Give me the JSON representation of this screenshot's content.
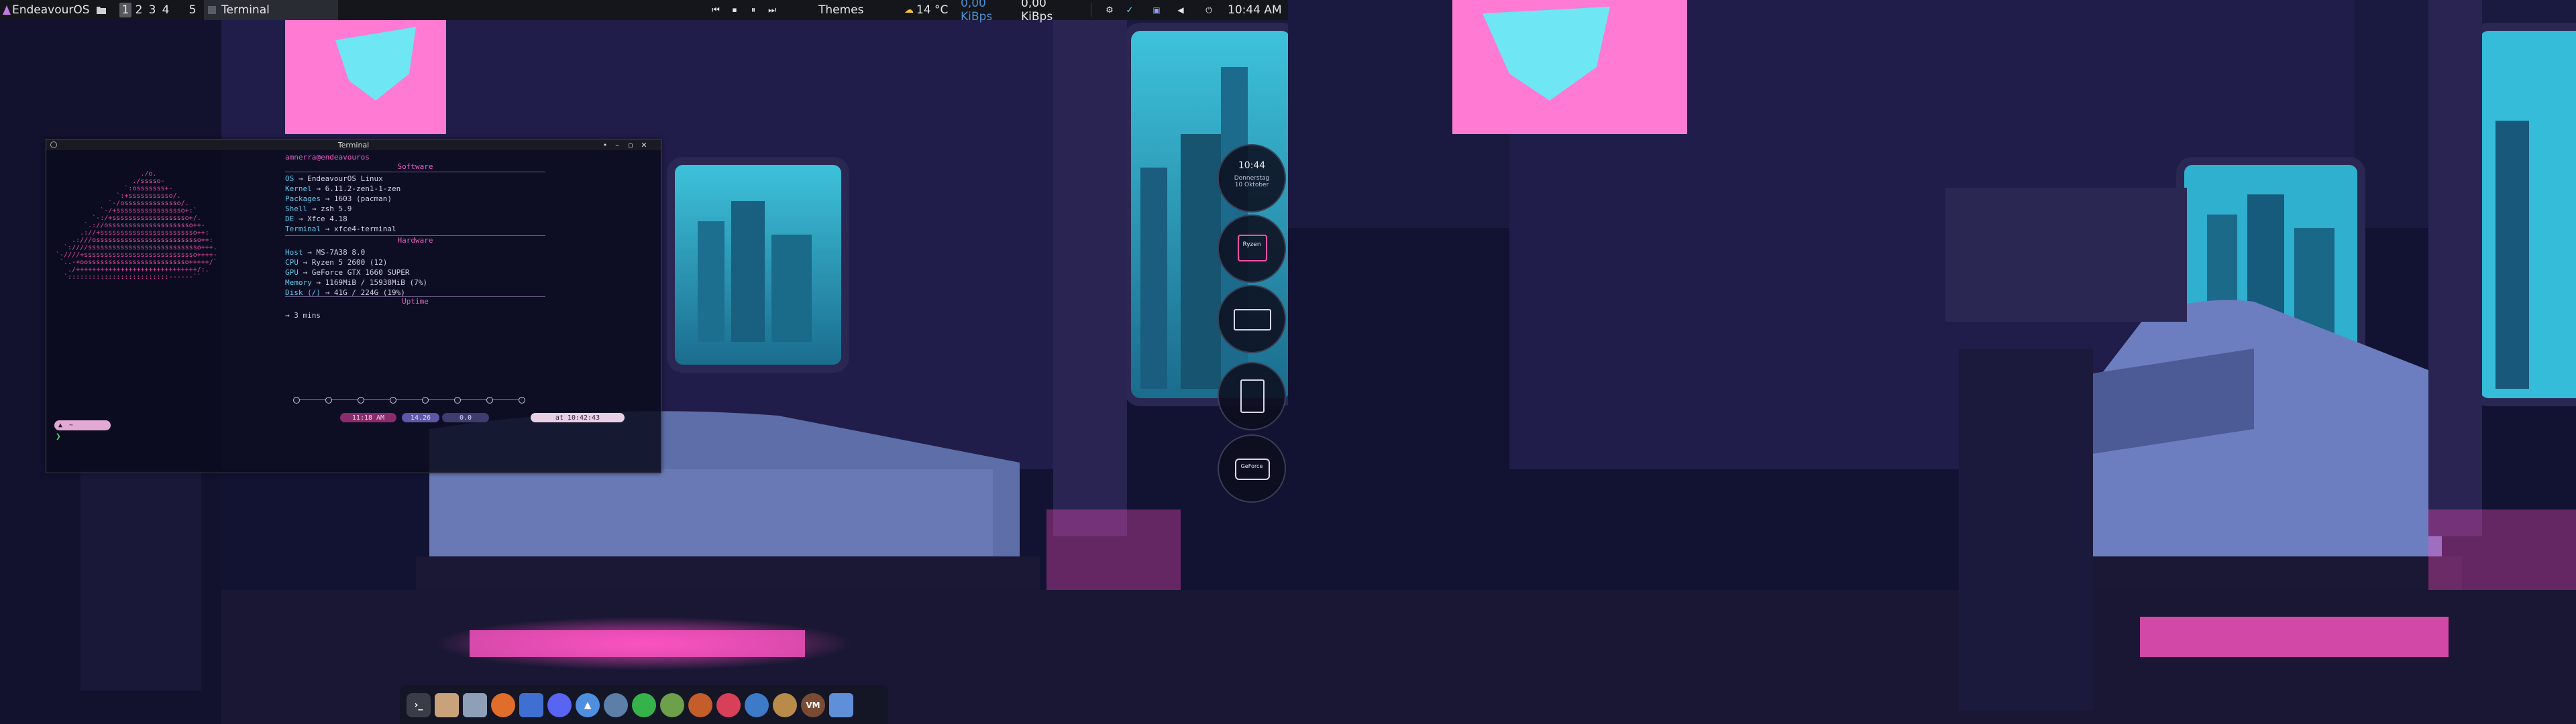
{
  "top_panel": {
    "app_menu_label": "EndeavourOS",
    "workspaces": [
      "1",
      "2",
      "3",
      "4",
      "5"
    ],
    "active_workspace": "1",
    "window_button_label": "Terminal",
    "themes_label": "Themes",
    "weather": "14 °C",
    "net_down": "0,00 KiBps",
    "net_up": "0,00 KiBps",
    "clock": "10:44 AM"
  },
  "terminal": {
    "title": "Terminal",
    "prompt_user": "amnerra@endeavouros",
    "ascii_logo": "                     ./o.\n                   ./sssso-\n                 `:osssssss+-\n               `:+sssssssssso/.\n             `-/ossssssssssssso/.\n           `-/+sssssssssssssssso+:`\n         `-:/+sssssssssssssssssso+/.\n       `.://osssssssssssssssssssso++-\n      .://+ssssssssssssssssssssssso++:\n    .:///ossssssssssssssssssssssssso++:\n  `:////ssssssssssssssssssssssssssso+++.\n`-////+ssssssssssssssssssssssssssso++++-\n `..-+oosssssssssssssssssssssssso+++++/`\n   ./++++++++++++++++++++++++++++++/:.\n  `:::::::::::::::::::::::::------``",
    "section_software": "Software",
    "section_hardware": "Hardware",
    "section_uptime": "Uptime",
    "arrow": "→",
    "software": [
      {
        "key": "OS",
        "value": "EndeavourOS Linux"
      },
      {
        "key": "Kernel",
        "value": "6.11.2-zen1-1-zen"
      },
      {
        "key": "Packages",
        "value": "1603 (pacman)"
      },
      {
        "key": "Shell",
        "value": "zsh 5.9"
      },
      {
        "key": "DE",
        "value": "Xfce 4.18"
      },
      {
        "key": "Terminal",
        "value": "xfce4-terminal"
      }
    ],
    "hardware": [
      {
        "key": "Host",
        "value": "MS-7A38 8.0"
      },
      {
        "key": "CPU",
        "value": "Ryzen 5 2600 (12)"
      },
      {
        "key": "GPU",
        "value": "GeForce GTX 1660 SUPER"
      },
      {
        "key": "Memory",
        "value": "1169MiB / 15938MiB (7%)"
      },
      {
        "key": "Disk (/)",
        "value": "41G / 224G (19%)"
      }
    ],
    "uptime": "3 mins",
    "status_pills": {
      "a": "11:18 AM",
      "b": "14.26",
      "c": "0.0",
      "time": "at 10:42:43"
    },
    "prompt_pill": "~",
    "cursor": "❯"
  },
  "conky": {
    "clock_time": "10:44",
    "clock_date": "Donnerstag\n10 Oktober",
    "cpu_label": "Ryzen",
    "storage_label": "GeForce"
  },
  "dock": {
    "icons": [
      "terminal-icon",
      "files-icon",
      "box-icon",
      "firefox-icon",
      "doc-icon",
      "discord-icon",
      "endeavour-icon",
      "steam-icon",
      "spotify-icon",
      "krita-icon",
      "pinta-icon",
      "music-icon",
      "steam2-icon",
      "gimp-icon",
      "vm-icon",
      "folder-icon"
    ],
    "vm_label": "VM"
  },
  "colors": {
    "accent_pink": "#e04aa8",
    "accent_cyan": "#5fc8e8",
    "panel_bg": "#15161b"
  }
}
